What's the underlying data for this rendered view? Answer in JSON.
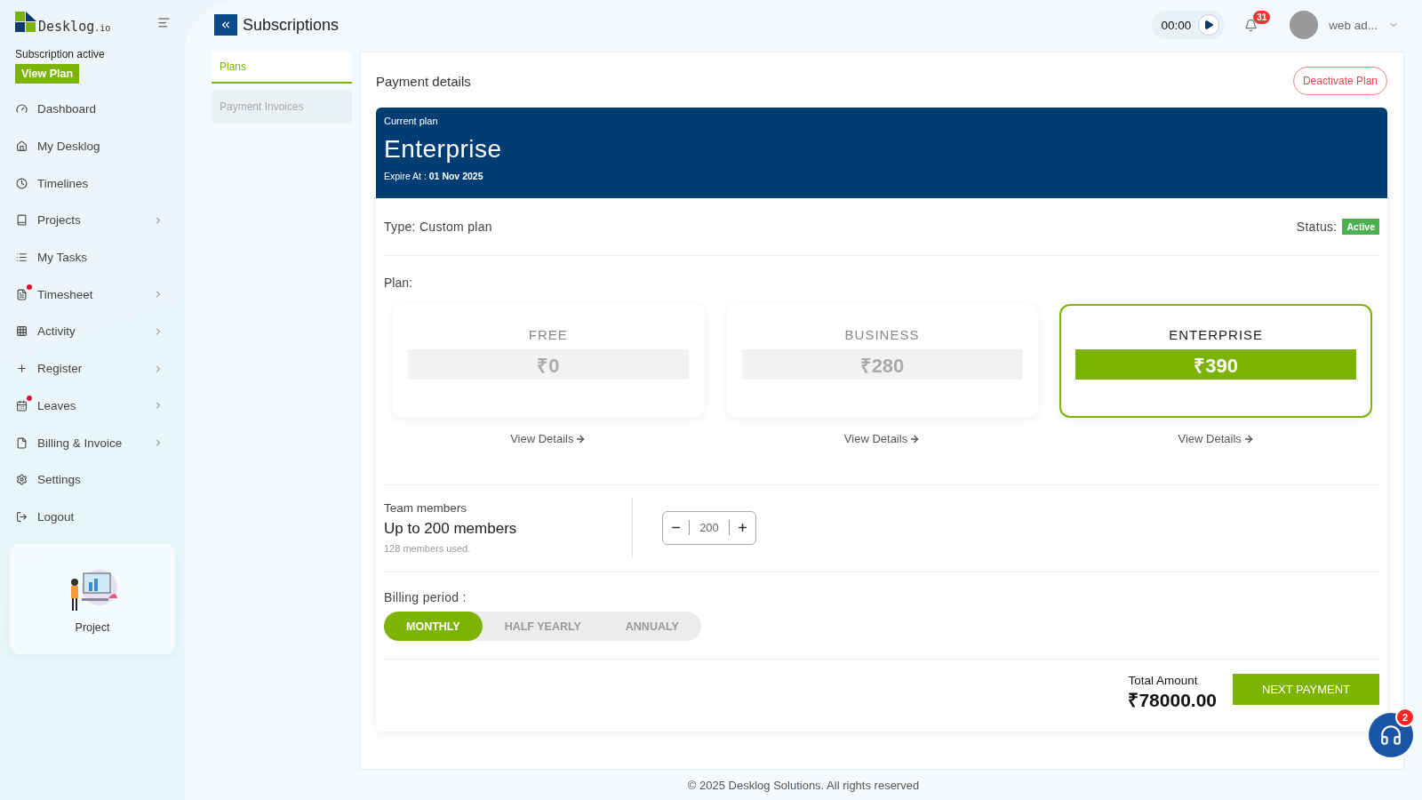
{
  "logo": {
    "name": "Desklog",
    "suffix": ".io"
  },
  "subscription": {
    "status": "Subscription active",
    "button": "View Plan"
  },
  "sidebar": {
    "items": [
      {
        "label": "Dashboard",
        "has_submenu": false,
        "notification": false
      },
      {
        "label": "My Desklog",
        "has_submenu": false,
        "notification": false
      },
      {
        "label": "Timelines",
        "has_submenu": false,
        "notification": false
      },
      {
        "label": "Projects",
        "has_submenu": true,
        "notification": false
      },
      {
        "label": "My Tasks",
        "has_submenu": false,
        "notification": false
      },
      {
        "label": "Timesheet",
        "has_submenu": true,
        "notification": true
      },
      {
        "label": "Activity",
        "has_submenu": true,
        "notification": false
      },
      {
        "label": "Register",
        "has_submenu": true,
        "notification": false
      },
      {
        "label": "Leaves",
        "has_submenu": true,
        "notification": true
      },
      {
        "label": "Billing & Invoice",
        "has_submenu": true,
        "notification": false
      },
      {
        "label": "Settings",
        "has_submenu": false,
        "notification": false
      },
      {
        "label": "Logout",
        "has_submenu": false,
        "notification": false
      }
    ]
  },
  "promo": {
    "label": "Project"
  },
  "header": {
    "title": "Subscriptions",
    "timer": "00:00",
    "notifications": "31",
    "user": "web ad..."
  },
  "tabs": [
    {
      "label": "Plans",
      "selected": true
    },
    {
      "label": "Payment Invoices",
      "selected": false
    }
  ],
  "payment": {
    "title": "Payment details",
    "deactivate": "Deactivate Plan",
    "current": {
      "caption": "Current plan",
      "name": "Enterprise",
      "expire_label": "Expire At :",
      "expire_date": "01 Nov 2025"
    },
    "type": "Type: Custom plan",
    "status_label": "Status:",
    "status": "Active",
    "plan_label": "Plan:",
    "plans": [
      {
        "name": "FREE",
        "price": "₹0",
        "link": "View Details",
        "selected": false
      },
      {
        "name": "BUSINESS",
        "price": "₹280",
        "link": "View Details",
        "selected": false
      },
      {
        "name": "ENTERPRISE",
        "price": "₹390",
        "link": "View Details",
        "selected": true
      }
    ],
    "team": {
      "label": "Team members",
      "value": "Up to 200 members",
      "note": "128 members used.",
      "count": "200"
    },
    "billing": {
      "label": "Billing period :",
      "options": [
        {
          "label": "MONTHLY",
          "selected": true
        },
        {
          "label": "HALF YEARLY",
          "selected": false
        },
        {
          "label": "ANNUALY",
          "selected": false
        }
      ]
    },
    "total": {
      "label": "Total Amount",
      "amount": "₹78000.00",
      "button": "NEXT PAYMENT"
    }
  },
  "footer": "© 2025 Desklog Solutions. All rights reserved",
  "chat": {
    "badge": "2"
  }
}
